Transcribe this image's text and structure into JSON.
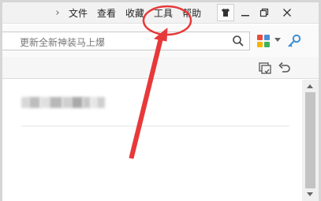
{
  "menu": {
    "items": [
      "文件",
      "查看",
      "收藏",
      "工具",
      "帮助"
    ]
  },
  "search": {
    "placeholder": "更新全新神装马上爆"
  },
  "annotation": {
    "color": "#e8393a"
  }
}
